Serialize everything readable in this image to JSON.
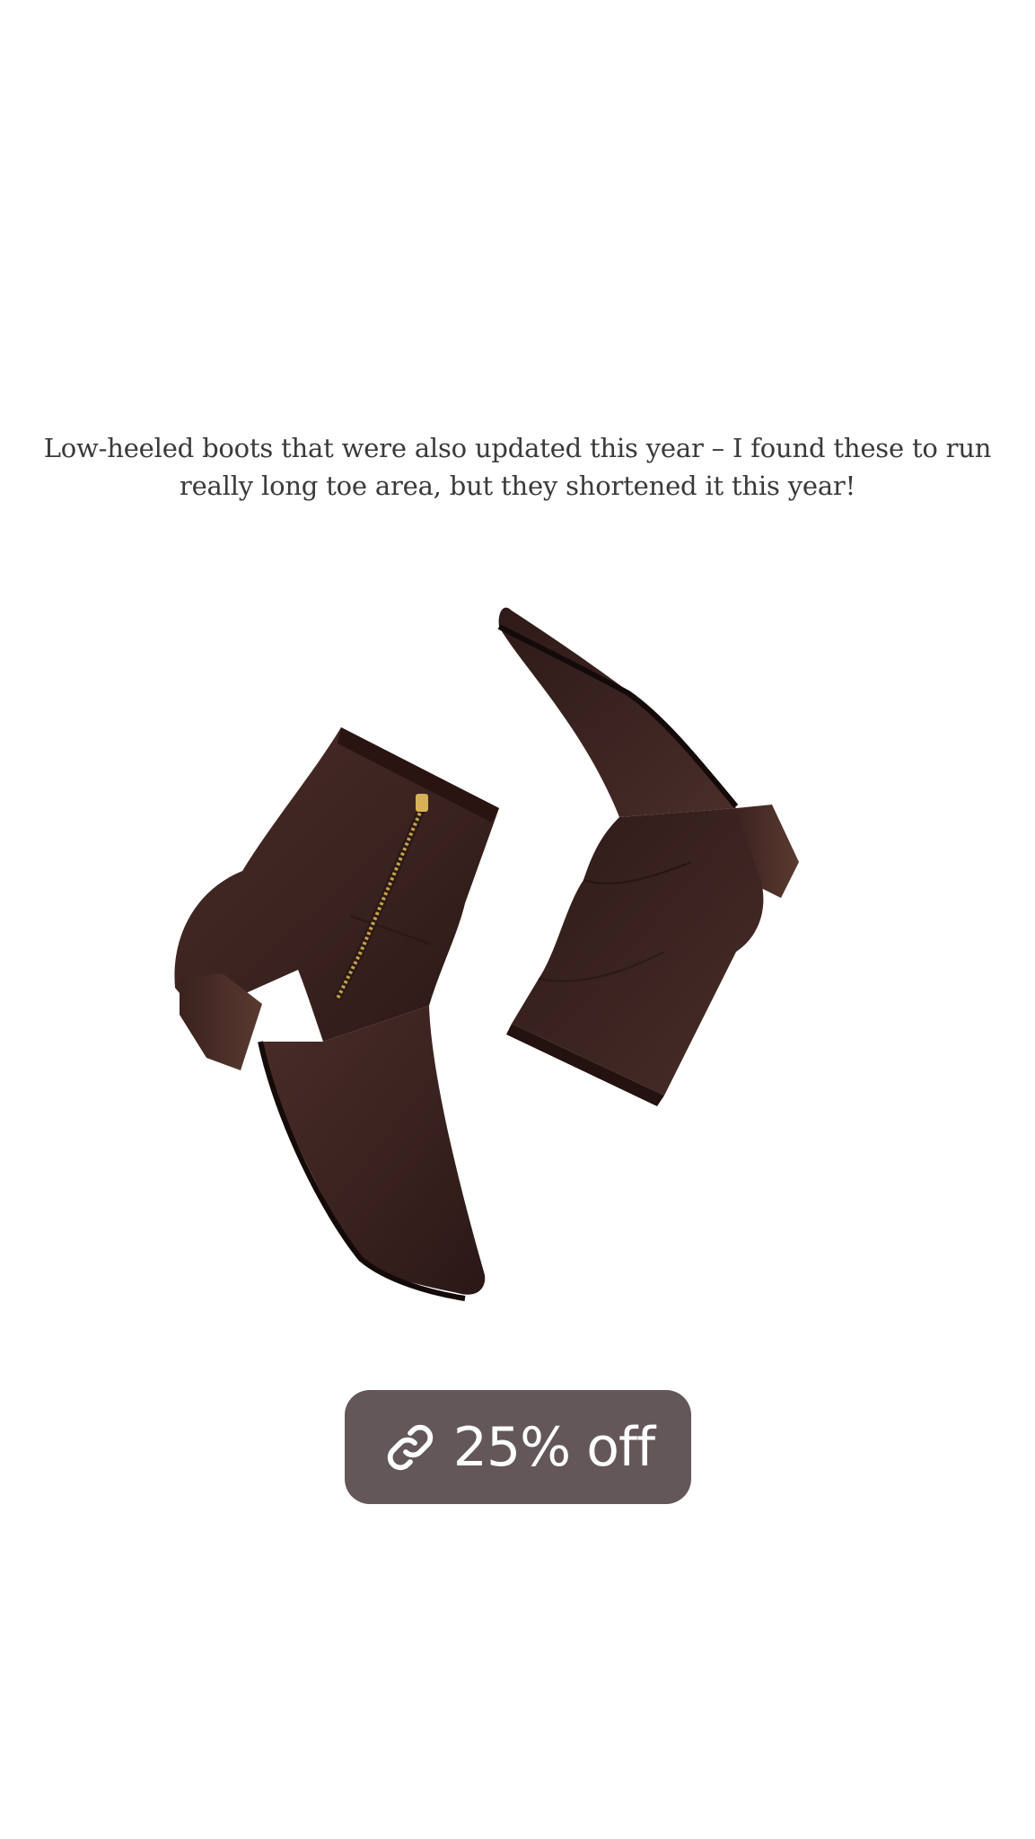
{
  "story": {
    "caption": "Low-heeled boots that were also updated this year – I found these to run really long toe area, but they shortened it this year!",
    "product_image": {
      "subject": "pair of dark brown leather low-heeled ankle boots with side zip"
    },
    "link_sticker": {
      "icon": "link-icon",
      "label": "25% off",
      "background_color": "#63575a",
      "text_color": "#ffffff"
    }
  },
  "colors": {
    "background": "#ffffff",
    "leather": "#3b2320",
    "heel": "#4a2e28",
    "zipper": "#c9a24a"
  }
}
